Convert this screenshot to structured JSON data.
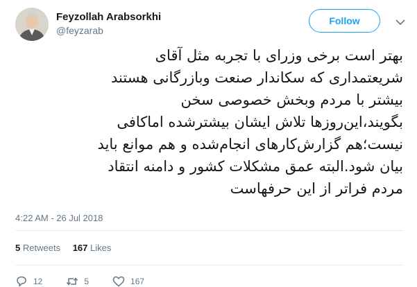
{
  "user": {
    "name": "Feyzollah Arabsorkhi",
    "handle": "@feyzarab"
  },
  "follow_label": "Follow",
  "tweet": {
    "text": "بهتر است برخی وزرای با تجربه مثل آقای\nشریعتمداری که سکاندار صنعت وبازرگانی هستند\nبیشتر با مردم وبخش خصوصی سخن\nبگویند،این‌روزها تلاش ایشان بیشترشده اماکافی\nنیست؛هم گزارش‌کارهای انجام‌شده و هم موانع باید\nبیان شود.البته عمق مشکلات کشور و دامنه انتقاد\nمردم فراتر از این حرفهاست",
    "timestamp": "4:22 AM - 26 Jul 2018"
  },
  "stats": {
    "retweets_count": "5",
    "retweets_label": "Retweets",
    "likes_count": "167",
    "likes_label": "Likes"
  },
  "actions": {
    "replies": "12",
    "retweets": "5",
    "likes": "167"
  },
  "colors": {
    "accent": "#1da1f2",
    "secondary_text": "#657786",
    "divider": "#e6ecf0"
  },
  "icons": [
    "caret-down-icon",
    "reply-icon",
    "retweet-icon",
    "heart-icon"
  ]
}
